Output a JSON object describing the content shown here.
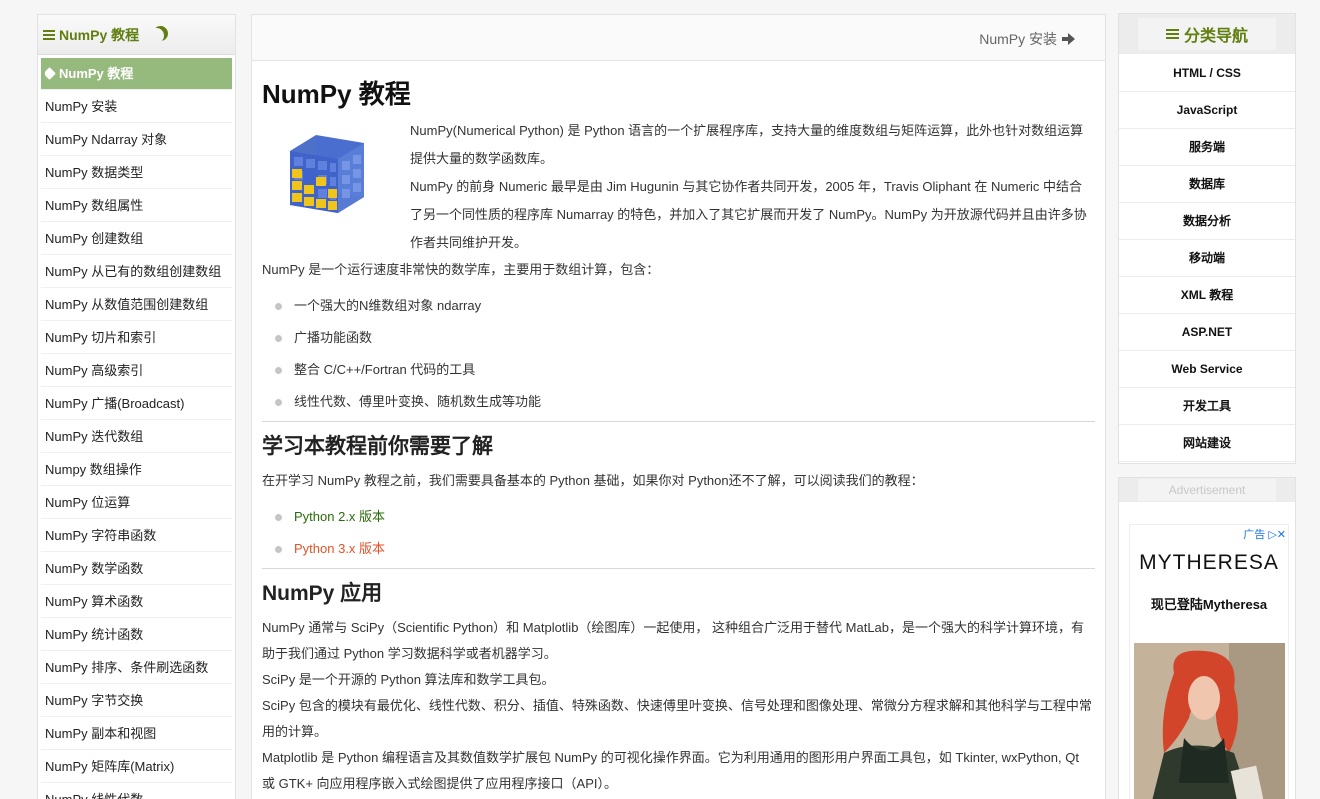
{
  "left_sidebar": {
    "title": "NumPy 教程",
    "items": [
      "NumPy 教程",
      "NumPy 安装",
      "NumPy Ndarray 对象",
      "NumPy 数据类型",
      "NumPy 数组属性",
      "NumPy 创建数组",
      "NumPy 从已有的数组创建数组",
      "NumPy 从数值范围创建数组",
      "NumPy 切片和索引",
      "NumPy 高级索引",
      "NumPy 广播(Broadcast)",
      "NumPy 迭代数组",
      "Numpy 数组操作",
      "NumPy 位运算",
      "NumPy 字符串函数",
      "NumPy 数学函数",
      "NumPy 算术函数",
      "NumPy 统计函数",
      "NumPy 排序、条件刷选函数",
      "NumPy 字节交换",
      "NumPy 副本和视图",
      "NumPy 矩阵库(Matrix)",
      "NumPy 线性代数"
    ]
  },
  "topbar": {
    "next_label": "NumPy 安装"
  },
  "article": {
    "title": "NumPy 教程",
    "intro_1": "NumPy(Numerical Python) 是 Python 语言的一个扩展程序库，支持大量的维度数组与矩阵运算，此外也针对数组运算提供大量的数学函数库。",
    "intro_2": "NumPy 的前身 Numeric 最早是由 Jim Hugunin 与其它协作者共同开发，2005 年，Travis Oliphant 在 Numeric 中结合了另一个同性质的程序库 Numarray 的特色，并加入了其它扩展而开发了 NumPy。NumPy 为开放源代码并且由许多协作者共同维护开发。",
    "p_features": "NumPy 是一个运行速度非常快的数学库，主要用于数组计算，包含：",
    "features": [
      "一个强大的N维数组对象 ndarray",
      "广播功能函数",
      "整合 C/C++/Fortran 代码的工具",
      "线性代数、傅里叶变换、随机数生成等功能"
    ],
    "h2_prereq": "学习本教程前你需要了解",
    "p_prereq": "在开学习 NumPy 教程之前，我们需要具备基本的 Python 基础，如果你对 Python还不了解，可以阅读我们的教程：",
    "links": [
      "Python 2.x 版本",
      "Python 3.x 版本"
    ],
    "h2_apps": "NumPy 应用",
    "apps_1": "NumPy 通常与 SciPy（Scientific Python）和 Matplotlib（绘图库）一起使用， 这种组合广泛用于替代 MatLab，是一个强大的科学计算环境，有助于我们通过 Python 学习数据科学或者机器学习。",
    "apps_2": "SciPy 是一个开源的 Python 算法库和数学工具包。",
    "apps_3": "SciPy 包含的模块有最优化、线性代数、积分、插值、特殊函数、快速傅里叶变换、信号处理和图像处理、常微分方程求解和其他科学与工程中常用的计算。",
    "apps_4": "Matplotlib 是 Python 编程语言及其数值数学扩展包 NumPy 的可视化操作界面。它为利用通用的图形用户界面工具包，如 Tkinter, wxPython, Qt 或 GTK+ 向应用程序嵌入式绘图提供了应用程序接口（API）。"
  },
  "right_nav": {
    "title": "分类导航",
    "items": [
      "HTML / CSS",
      "JavaScript",
      "服务端",
      "数据库",
      "数据分析",
      "移动端",
      "XML 教程",
      "ASP.NET",
      "Web Service",
      "开发工具",
      "网站建设"
    ]
  },
  "ad": {
    "label": "Advertisement",
    "adchoice": "广告",
    "brand": "MYTHERESA",
    "slogan": "现已登陆Mytheresa"
  },
  "colors": {
    "accent": "#617f10",
    "active_bg": "#96b97d",
    "link_green": "#2b6b09",
    "link_red": "#e2532a"
  }
}
